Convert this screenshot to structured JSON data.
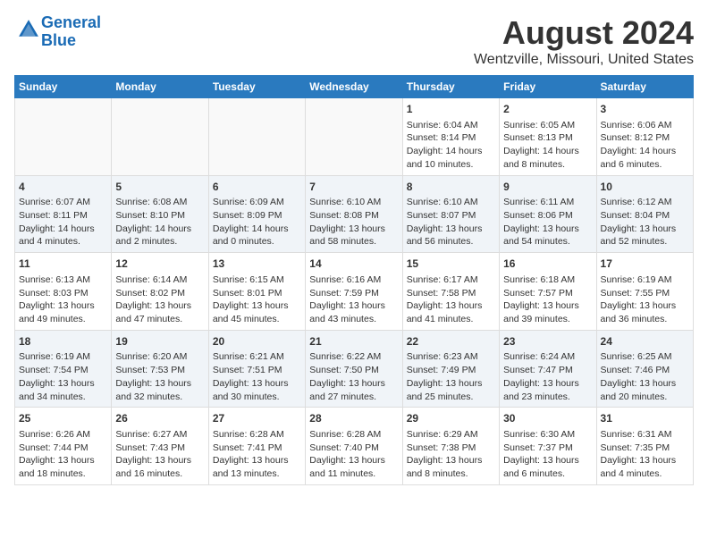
{
  "header": {
    "logo_line1": "General",
    "logo_line2": "Blue",
    "main_title": "August 2024",
    "subtitle": "Wentzville, Missouri, United States"
  },
  "days_of_week": [
    "Sunday",
    "Monday",
    "Tuesday",
    "Wednesday",
    "Thursday",
    "Friday",
    "Saturday"
  ],
  "weeks": [
    [
      {
        "num": "",
        "info": ""
      },
      {
        "num": "",
        "info": ""
      },
      {
        "num": "",
        "info": ""
      },
      {
        "num": "",
        "info": ""
      },
      {
        "num": "1",
        "info": "Sunrise: 6:04 AM\nSunset: 8:14 PM\nDaylight: 14 hours\nand 10 minutes."
      },
      {
        "num": "2",
        "info": "Sunrise: 6:05 AM\nSunset: 8:13 PM\nDaylight: 14 hours\nand 8 minutes."
      },
      {
        "num": "3",
        "info": "Sunrise: 6:06 AM\nSunset: 8:12 PM\nDaylight: 14 hours\nand 6 minutes."
      }
    ],
    [
      {
        "num": "4",
        "info": "Sunrise: 6:07 AM\nSunset: 8:11 PM\nDaylight: 14 hours\nand 4 minutes."
      },
      {
        "num": "5",
        "info": "Sunrise: 6:08 AM\nSunset: 8:10 PM\nDaylight: 14 hours\nand 2 minutes."
      },
      {
        "num": "6",
        "info": "Sunrise: 6:09 AM\nSunset: 8:09 PM\nDaylight: 14 hours\nand 0 minutes."
      },
      {
        "num": "7",
        "info": "Sunrise: 6:10 AM\nSunset: 8:08 PM\nDaylight: 13 hours\nand 58 minutes."
      },
      {
        "num": "8",
        "info": "Sunrise: 6:10 AM\nSunset: 8:07 PM\nDaylight: 13 hours\nand 56 minutes."
      },
      {
        "num": "9",
        "info": "Sunrise: 6:11 AM\nSunset: 8:06 PM\nDaylight: 13 hours\nand 54 minutes."
      },
      {
        "num": "10",
        "info": "Sunrise: 6:12 AM\nSunset: 8:04 PM\nDaylight: 13 hours\nand 52 minutes."
      }
    ],
    [
      {
        "num": "11",
        "info": "Sunrise: 6:13 AM\nSunset: 8:03 PM\nDaylight: 13 hours\nand 49 minutes."
      },
      {
        "num": "12",
        "info": "Sunrise: 6:14 AM\nSunset: 8:02 PM\nDaylight: 13 hours\nand 47 minutes."
      },
      {
        "num": "13",
        "info": "Sunrise: 6:15 AM\nSunset: 8:01 PM\nDaylight: 13 hours\nand 45 minutes."
      },
      {
        "num": "14",
        "info": "Sunrise: 6:16 AM\nSunset: 7:59 PM\nDaylight: 13 hours\nand 43 minutes."
      },
      {
        "num": "15",
        "info": "Sunrise: 6:17 AM\nSunset: 7:58 PM\nDaylight: 13 hours\nand 41 minutes."
      },
      {
        "num": "16",
        "info": "Sunrise: 6:18 AM\nSunset: 7:57 PM\nDaylight: 13 hours\nand 39 minutes."
      },
      {
        "num": "17",
        "info": "Sunrise: 6:19 AM\nSunset: 7:55 PM\nDaylight: 13 hours\nand 36 minutes."
      }
    ],
    [
      {
        "num": "18",
        "info": "Sunrise: 6:19 AM\nSunset: 7:54 PM\nDaylight: 13 hours\nand 34 minutes."
      },
      {
        "num": "19",
        "info": "Sunrise: 6:20 AM\nSunset: 7:53 PM\nDaylight: 13 hours\nand 32 minutes."
      },
      {
        "num": "20",
        "info": "Sunrise: 6:21 AM\nSunset: 7:51 PM\nDaylight: 13 hours\nand 30 minutes."
      },
      {
        "num": "21",
        "info": "Sunrise: 6:22 AM\nSunset: 7:50 PM\nDaylight: 13 hours\nand 27 minutes."
      },
      {
        "num": "22",
        "info": "Sunrise: 6:23 AM\nSunset: 7:49 PM\nDaylight: 13 hours\nand 25 minutes."
      },
      {
        "num": "23",
        "info": "Sunrise: 6:24 AM\nSunset: 7:47 PM\nDaylight: 13 hours\nand 23 minutes."
      },
      {
        "num": "24",
        "info": "Sunrise: 6:25 AM\nSunset: 7:46 PM\nDaylight: 13 hours\nand 20 minutes."
      }
    ],
    [
      {
        "num": "25",
        "info": "Sunrise: 6:26 AM\nSunset: 7:44 PM\nDaylight: 13 hours\nand 18 minutes."
      },
      {
        "num": "26",
        "info": "Sunrise: 6:27 AM\nSunset: 7:43 PM\nDaylight: 13 hours\nand 16 minutes."
      },
      {
        "num": "27",
        "info": "Sunrise: 6:28 AM\nSunset: 7:41 PM\nDaylight: 13 hours\nand 13 minutes."
      },
      {
        "num": "28",
        "info": "Sunrise: 6:28 AM\nSunset: 7:40 PM\nDaylight: 13 hours\nand 11 minutes."
      },
      {
        "num": "29",
        "info": "Sunrise: 6:29 AM\nSunset: 7:38 PM\nDaylight: 13 hours\nand 8 minutes."
      },
      {
        "num": "30",
        "info": "Sunrise: 6:30 AM\nSunset: 7:37 PM\nDaylight: 13 hours\nand 6 minutes."
      },
      {
        "num": "31",
        "info": "Sunrise: 6:31 AM\nSunset: 7:35 PM\nDaylight: 13 hours\nand 4 minutes."
      }
    ]
  ]
}
